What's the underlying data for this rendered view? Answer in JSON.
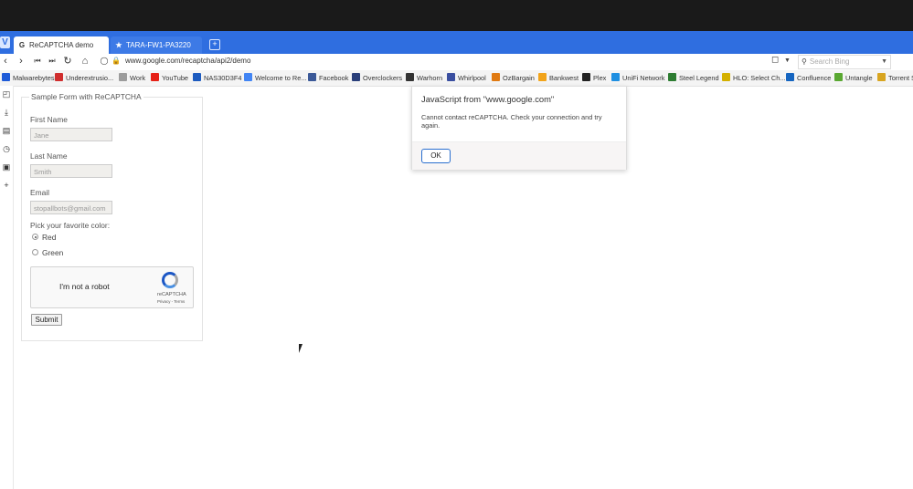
{
  "browser": {
    "tabs": [
      {
        "label": "ReCAPTCHA demo",
        "icon": "G"
      },
      {
        "label": "TARA-FW1-PA3220",
        "icon": "★"
      }
    ],
    "url": "www.google.com/recaptcha/api2/demo",
    "search_placeholder": "Search Bing"
  },
  "bookmarks": [
    {
      "label": "Malwarebytes",
      "color": "#1e5bd8"
    },
    {
      "label": "Underextrusio...",
      "color": "#d02f2f"
    },
    {
      "label": "Work",
      "color": "#9c9c9c"
    },
    {
      "label": "YouTube",
      "color": "#e62117"
    },
    {
      "label": "NAS30D3F4",
      "color": "#1d5bbf"
    },
    {
      "label": "Welcome to Re...",
      "color": "#4285f4"
    },
    {
      "label": "Facebook",
      "color": "#3b5998"
    },
    {
      "label": "Overclockers",
      "color": "#2a3f7a"
    },
    {
      "label": "Warhorn",
      "color": "#333333"
    },
    {
      "label": "Whirlpool",
      "color": "#3a4fa0"
    },
    {
      "label": "OzBargain",
      "color": "#e07a12"
    },
    {
      "label": "Bankwest",
      "color": "#f2a41b"
    },
    {
      "label": "Plex",
      "color": "#222222"
    },
    {
      "label": "UniFi Network",
      "color": "#1f8fe1"
    },
    {
      "label": "Steel Legend",
      "color": "#2e7d32"
    },
    {
      "label": "HLO: Select Ch...",
      "color": "#d4b000"
    },
    {
      "label": "Confluence",
      "color": "#1565c0"
    },
    {
      "label": "Untangle",
      "color": "#5aa832"
    },
    {
      "label": "Torrent S",
      "color": "#d8a520"
    }
  ],
  "form": {
    "legend": "Sample Form with ReCAPTCHA",
    "first_name_label": "First Name",
    "first_name_placeholder": "Jane",
    "last_name_label": "Last Name",
    "last_name_placeholder": "Smith",
    "email_label": "Email",
    "email_placeholder": "stopallbots@gmail.com",
    "color_label": "Pick your favorite color:",
    "color_options": [
      "Red",
      "Green"
    ],
    "captcha_text": "I'm not a robot",
    "captcha_brand": "reCAPTCHA",
    "captcha_terms": "Privacy - Terms",
    "submit_label": "Submit"
  },
  "dialog": {
    "title": "JavaScript from \"www.google.com\"",
    "message": "Cannot contact reCAPTCHA. Check your connection and try again.",
    "ok_label": "OK"
  }
}
